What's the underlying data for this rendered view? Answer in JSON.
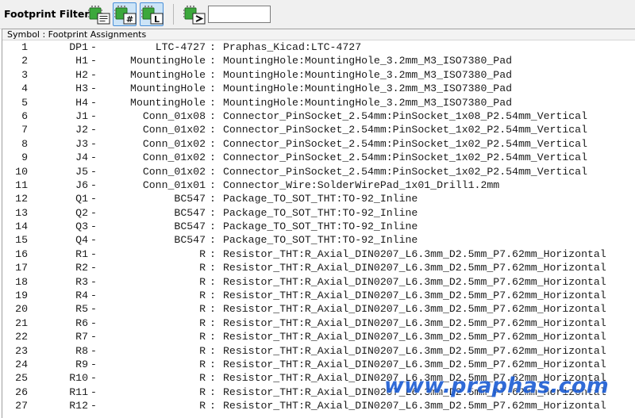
{
  "toolbar": {
    "label": "Footprint Filters:",
    "buttons": [
      {
        "name": "filter-by-keywords",
        "icon": "footprint-keywords-icon",
        "active": false
      },
      {
        "name": "filter-by-pin-count",
        "icon": "footprint-pin-count-icon",
        "active": true
      },
      {
        "name": "filter-by-library",
        "icon": "footprint-library-icon",
        "active": true
      },
      {
        "name": "filter-by-name",
        "icon": "footprint-name-filter-icon",
        "active": false
      }
    ],
    "filter_input": {
      "value": "",
      "placeholder": ""
    }
  },
  "panel": {
    "header": "Symbol : Footprint Assignments",
    "dash": "-",
    "separator": ":",
    "rows": [
      {
        "idx": "1",
        "ref": "DP1",
        "value": "LTC-4727",
        "footprint": "Praphas_Kicad:LTC-4727"
      },
      {
        "idx": "2",
        "ref": "H1",
        "value": "MountingHole",
        "footprint": "MountingHole:MountingHole_3.2mm_M3_ISO7380_Pad"
      },
      {
        "idx": "3",
        "ref": "H2",
        "value": "MountingHole",
        "footprint": "MountingHole:MountingHole_3.2mm_M3_ISO7380_Pad"
      },
      {
        "idx": "4",
        "ref": "H3",
        "value": "MountingHole",
        "footprint": "MountingHole:MountingHole_3.2mm_M3_ISO7380_Pad"
      },
      {
        "idx": "5",
        "ref": "H4",
        "value": "MountingHole",
        "footprint": "MountingHole:MountingHole_3.2mm_M3_ISO7380_Pad"
      },
      {
        "idx": "6",
        "ref": "J1",
        "value": "Conn_01x08",
        "footprint": "Connector_PinSocket_2.54mm:PinSocket_1x08_P2.54mm_Vertical"
      },
      {
        "idx": "7",
        "ref": "J2",
        "value": "Conn_01x02",
        "footprint": "Connector_PinSocket_2.54mm:PinSocket_1x02_P2.54mm_Vertical"
      },
      {
        "idx": "8",
        "ref": "J3",
        "value": "Conn_01x02",
        "footprint": "Connector_PinSocket_2.54mm:PinSocket_1x02_P2.54mm_Vertical"
      },
      {
        "idx": "9",
        "ref": "J4",
        "value": "Conn_01x02",
        "footprint": "Connector_PinSocket_2.54mm:PinSocket_1x02_P2.54mm_Vertical"
      },
      {
        "idx": "10",
        "ref": "J5",
        "value": "Conn_01x02",
        "footprint": "Connector_PinSocket_2.54mm:PinSocket_1x02_P2.54mm_Vertical"
      },
      {
        "idx": "11",
        "ref": "J6",
        "value": "Conn_01x01",
        "footprint": "Connector_Wire:SolderWirePad_1x01_Drill1.2mm"
      },
      {
        "idx": "12",
        "ref": "Q1",
        "value": "BC547",
        "footprint": "Package_TO_SOT_THT:TO-92_Inline"
      },
      {
        "idx": "13",
        "ref": "Q2",
        "value": "BC547",
        "footprint": "Package_TO_SOT_THT:TO-92_Inline"
      },
      {
        "idx": "14",
        "ref": "Q3",
        "value": "BC547",
        "footprint": "Package_TO_SOT_THT:TO-92_Inline"
      },
      {
        "idx": "15",
        "ref": "Q4",
        "value": "BC547",
        "footprint": "Package_TO_SOT_THT:TO-92_Inline"
      },
      {
        "idx": "16",
        "ref": "R1",
        "value": "R",
        "footprint": "Resistor_THT:R_Axial_DIN0207_L6.3mm_D2.5mm_P7.62mm_Horizontal"
      },
      {
        "idx": "17",
        "ref": "R2",
        "value": "R",
        "footprint": "Resistor_THT:R_Axial_DIN0207_L6.3mm_D2.5mm_P7.62mm_Horizontal"
      },
      {
        "idx": "18",
        "ref": "R3",
        "value": "R",
        "footprint": "Resistor_THT:R_Axial_DIN0207_L6.3mm_D2.5mm_P7.62mm_Horizontal"
      },
      {
        "idx": "19",
        "ref": "R4",
        "value": "R",
        "footprint": "Resistor_THT:R_Axial_DIN0207_L6.3mm_D2.5mm_P7.62mm_Horizontal"
      },
      {
        "idx": "20",
        "ref": "R5",
        "value": "R",
        "footprint": "Resistor_THT:R_Axial_DIN0207_L6.3mm_D2.5mm_P7.62mm_Horizontal"
      },
      {
        "idx": "21",
        "ref": "R6",
        "value": "R",
        "footprint": "Resistor_THT:R_Axial_DIN0207_L6.3mm_D2.5mm_P7.62mm_Horizontal"
      },
      {
        "idx": "22",
        "ref": "R7",
        "value": "R",
        "footprint": "Resistor_THT:R_Axial_DIN0207_L6.3mm_D2.5mm_P7.62mm_Horizontal"
      },
      {
        "idx": "23",
        "ref": "R8",
        "value": "R",
        "footprint": "Resistor_THT:R_Axial_DIN0207_L6.3mm_D2.5mm_P7.62mm_Horizontal"
      },
      {
        "idx": "24",
        "ref": "R9",
        "value": "R",
        "footprint": "Resistor_THT:R_Axial_DIN0207_L6.3mm_D2.5mm_P7.62mm_Horizontal"
      },
      {
        "idx": "25",
        "ref": "R10",
        "value": "R",
        "footprint": "Resistor_THT:R_Axial_DIN0207_L6.3mm_D2.5mm_P7.62mm_Horizontal"
      },
      {
        "idx": "26",
        "ref": "R11",
        "value": "R",
        "footprint": "Resistor_THT:R_Axial_DIN0207_L6.3mm_D2.5mm_P7.62mm_Horizontal"
      },
      {
        "idx": "27",
        "ref": "R12",
        "value": "R",
        "footprint": "Resistor_THT:R_Axial_DIN0207_L6.3mm_D2.5mm_P7.62mm_Horizontal"
      }
    ]
  },
  "watermark": "www.praphas.com",
  "colors": {
    "chip_green": "#3ca83c",
    "active_button_bg": "#cce4f7",
    "active_button_border": "#4a90d9",
    "watermark": "#1f5fd4"
  }
}
